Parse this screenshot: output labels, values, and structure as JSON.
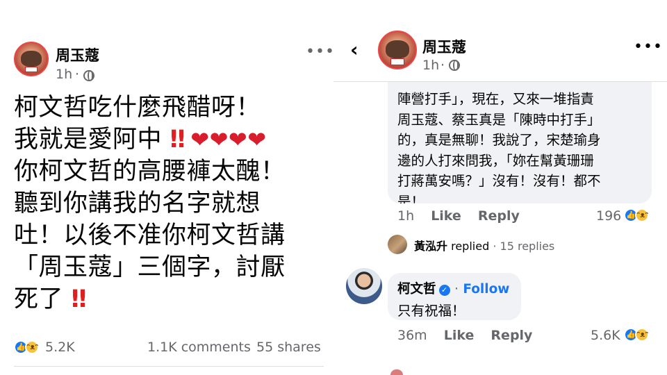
{
  "left_post": {
    "author": "周玉蔻",
    "time": "1h",
    "dot": "·",
    "menu": "•••",
    "lines": [
      "柯文哲吃什麼飛醋呀！",
      "我就是愛阿中",
      "你柯文哲的高腰褲太醜！",
      "聽到你講我的名字就想",
      "吐！以後不准你柯文哲講",
      "「周玉蔻」三個字，討厭",
      "死了"
    ],
    "bang": "‼",
    "hearts": "❤❤❤❤",
    "reaction_count": "5.2K",
    "comments": "1.1K comments",
    "shares": "55 shares",
    "icons": {
      "like": "like-icon",
      "haha": "haha-icon",
      "globe": "globe-icon"
    }
  },
  "right_post": {
    "back": "‹",
    "author": "周玉蔻",
    "time": "1h",
    "dot": "·",
    "menu": "•••",
    "comment1": {
      "cut_line": "陣營打手」，現在，又來一堆指責",
      "lines": [
        "陣營打手」，現在，又來一堆指責",
        "周玉蔻、蔡玉真是「陳時中打手」",
        "的，真是無聊！我說了，宋楚瑜身",
        "邊的人打來問我，「妳在幫黃珊珊",
        "打蔣萬安嗎？」沒有！沒有！都不",
        "是！"
      ],
      "time": "1h",
      "like": "Like",
      "reply": "Reply",
      "reaction_count": "196"
    },
    "reply_summary": {
      "name": "黃泓升",
      "action": "replied",
      "sep": "·",
      "count": "15 replies"
    },
    "comment2": {
      "author": "柯文哲",
      "sep": "·",
      "follow": "Follow",
      "verified": "✓",
      "text": "只有祝福！",
      "time": "36m",
      "like": "Like",
      "reply": "Reply",
      "reaction_count": "5.6K"
    }
  },
  "colors": {
    "facebook_blue": "#1877f2",
    "muted_text": "#65676b",
    "bubble_bg": "#f0f2f5",
    "heart_red": "#d81e2c"
  }
}
